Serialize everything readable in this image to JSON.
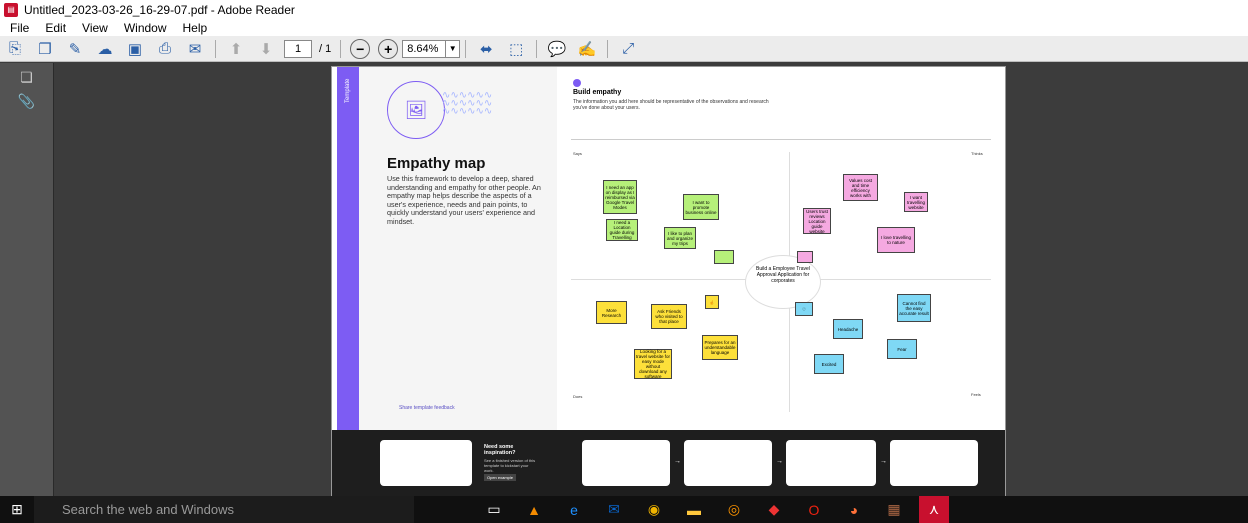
{
  "window": {
    "title": "Untitled_2023-03-26_16-29-07.pdf - Adobe Reader"
  },
  "menu": [
    "File",
    "Edit",
    "View",
    "Window",
    "Help"
  ],
  "toolbar": {
    "page_current": "1",
    "page_total": "/ 1",
    "zoom": "8.64%"
  },
  "left_page": {
    "tag": "Template",
    "title": "Empathy map",
    "description": "Use this framework to develop a deep, shared understanding and empathy for other people. An empathy map helps describe the aspects of a user's experience, needs and pain points, to quickly understand your users' experience and mindset.",
    "feedback": "Share template feedback"
  },
  "right_page": {
    "heading": "Build empathy",
    "description": "The information you add here should be representative of the observations and research you've done about your users.",
    "center": "Build a Employee Travel Approval Application for corporates",
    "quadrants": {
      "says": "Says",
      "thinks": "Thinks",
      "does": "Does",
      "feels": "Feels"
    },
    "notes": [
      {
        "text": "I need an app on display as I reimbursed via Google Travel Modes",
        "color": "g"
      },
      {
        "text": "I want to promote business online",
        "color": "g"
      },
      {
        "text": "I need a Location guide during Travelling",
        "color": "g"
      },
      {
        "text": "I like to plan and organize my trips",
        "color": "g"
      },
      {
        "text": "Values cost and time efficiency works with",
        "color": "p"
      },
      {
        "text": "I want travelling website",
        "color": "p"
      },
      {
        "text": "Users trust reviews Location guide website",
        "color": "p"
      },
      {
        "text": "I love travelling to nature",
        "color": "p"
      },
      {
        "text": "More Research",
        "color": "y"
      },
      {
        "text": "Ask Friends who visited to that place",
        "color": "y"
      },
      {
        "text": "Prepares for an understandable language",
        "color": "y"
      },
      {
        "text": "Looking for a travel website for easy mode without download any software",
        "color": "y"
      },
      {
        "text": "Cannot find the easy accurate result",
        "color": "b"
      },
      {
        "text": "Headache",
        "color": "b"
      },
      {
        "text": "Fear",
        "color": "b"
      },
      {
        "text": "Excited",
        "color": "b"
      }
    ]
  },
  "strip": {
    "heading": "Need some inspiration?",
    "sub": "See a finished version of this template to kickstart your work.",
    "btn": "Open example"
  },
  "taskbar": {
    "search": "Search the web and Windows"
  }
}
